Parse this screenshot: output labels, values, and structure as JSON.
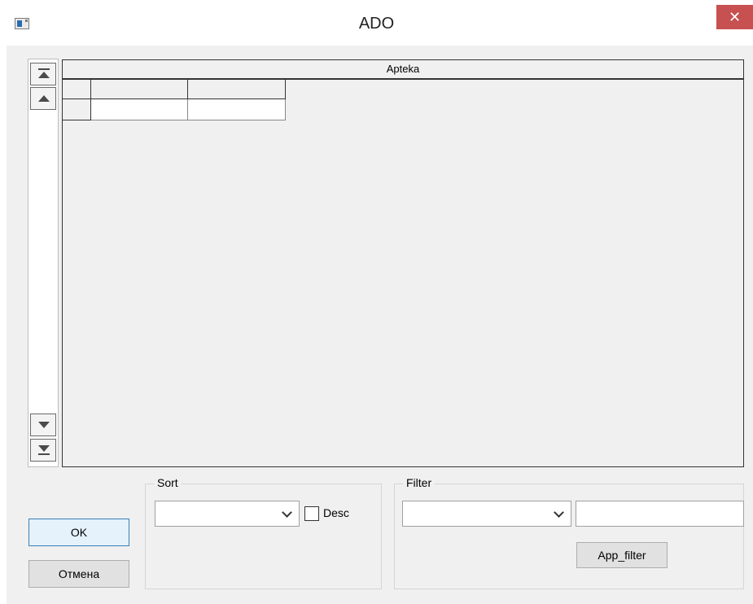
{
  "window": {
    "title": "ADO",
    "close_glyph": "✕",
    "icon": "app-window-icon"
  },
  "grid": {
    "caption": "Apteka",
    "columns": [
      "",
      ""
    ],
    "rows": [
      [
        "",
        ""
      ]
    ]
  },
  "navigator": {
    "buttons": [
      "first-record",
      "prior-record",
      "next-record",
      "last-record"
    ]
  },
  "buttons": {
    "ok": "OK",
    "cancel": "Отмена",
    "apply_filter": "App_filter"
  },
  "sort": {
    "group_label": "Sort",
    "field_value": "",
    "desc_label": "Desc",
    "desc_checked": false
  },
  "filter": {
    "group_label": "Filter",
    "field_value": "",
    "value_text": ""
  },
  "colors": {
    "close_button": "#c75050",
    "window_bg": "#f0f0f0",
    "default_button_border": "#3c7fb1"
  }
}
